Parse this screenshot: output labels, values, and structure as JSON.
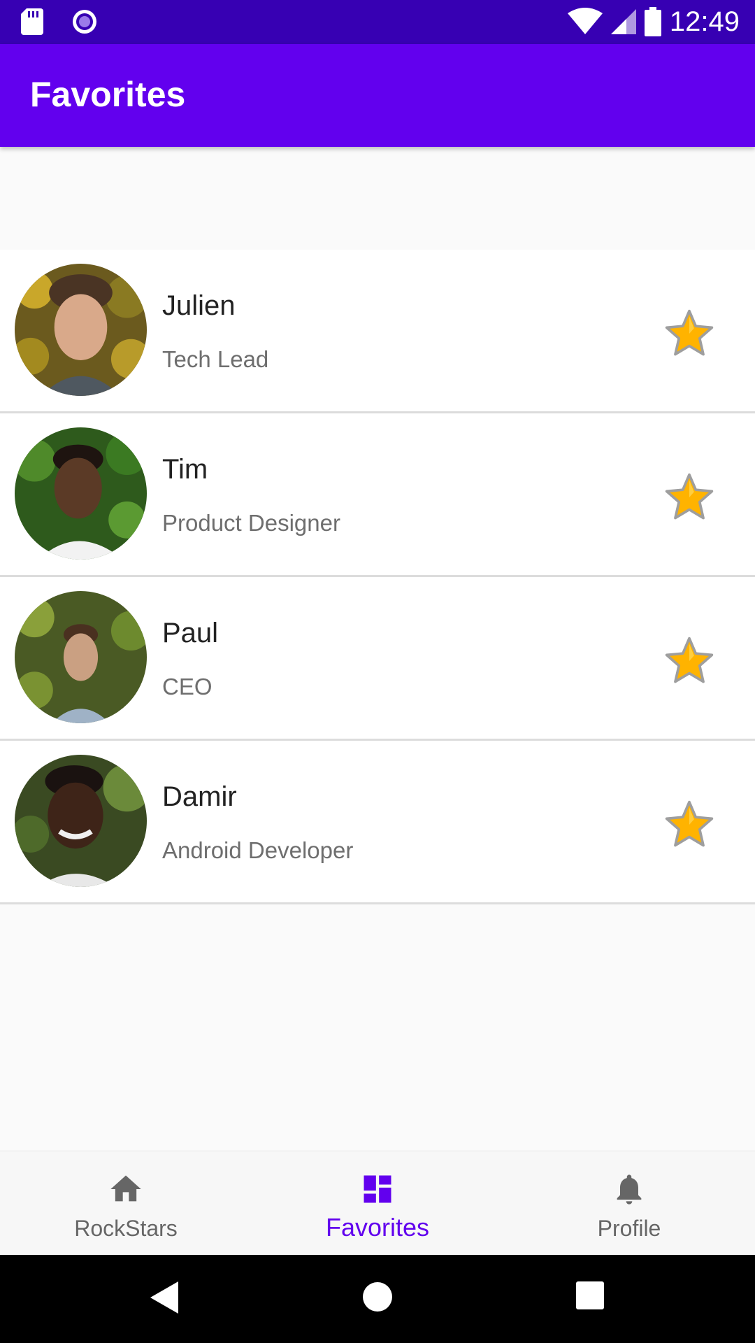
{
  "status_bar": {
    "time": "12:49",
    "icons": [
      "sd-card-icon",
      "circle-notification-icon",
      "wifi-icon",
      "signal-icon",
      "battery-icon"
    ]
  },
  "app_bar": {
    "title": "Favorites"
  },
  "favorites": [
    {
      "name": "Julien",
      "role": "Tech Lead",
      "favorited": true
    },
    {
      "name": "Tim",
      "role": "Product Designer",
      "favorited": true
    },
    {
      "name": "Paul",
      "role": "CEO",
      "favorited": true
    },
    {
      "name": "Damir",
      "role": "Android Developer",
      "favorited": true
    }
  ],
  "bottom_nav": {
    "items": [
      {
        "label": "RockStars",
        "icon": "home-icon",
        "active": false
      },
      {
        "label": "Favorites",
        "icon": "dashboard-icon",
        "active": true
      },
      {
        "label": "Profile",
        "icon": "bell-icon",
        "active": false
      }
    ]
  },
  "colors": {
    "status_bar": "#3700b3",
    "primary": "#6200ee",
    "star": "#ffb300",
    "inactive_nav": "#666666"
  }
}
